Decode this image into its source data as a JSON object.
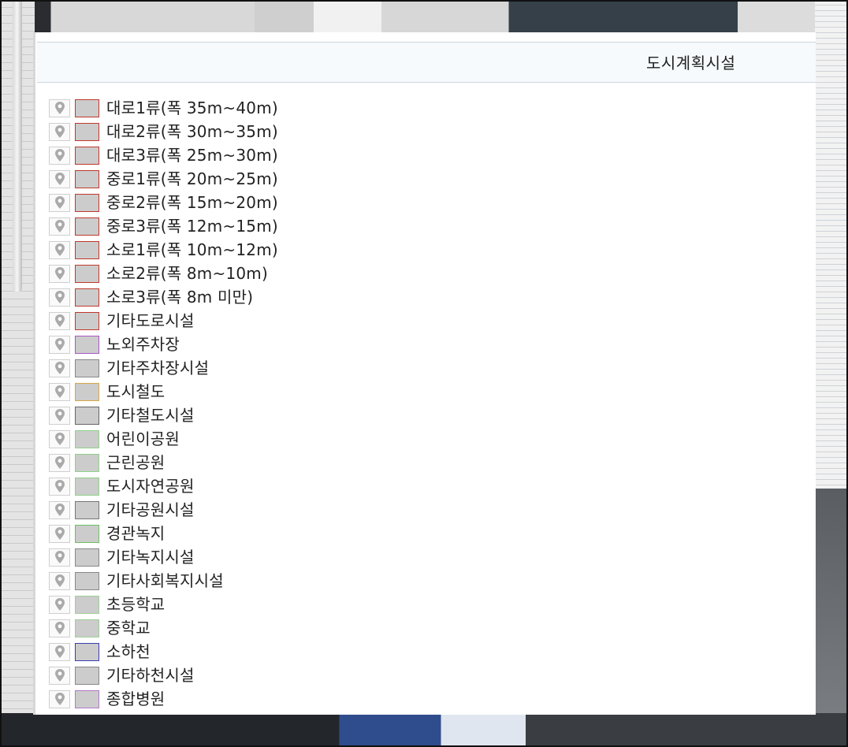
{
  "panel": {
    "title": "도시계획시설"
  },
  "legend": [
    {
      "label": "대로1류(폭 35m~40m)",
      "border": "#c0392b"
    },
    {
      "label": "대로2류(폭 30m~35m)",
      "border": "#c0392b"
    },
    {
      "label": "대로3류(폭 25m~30m)",
      "border": "#c0392b"
    },
    {
      "label": "중로1류(폭 20m~25m)",
      "border": "#c0392b"
    },
    {
      "label": "중로2류(폭 15m~20m)",
      "border": "#c0392b"
    },
    {
      "label": "중로3류(폭 12m~15m)",
      "border": "#c0392b"
    },
    {
      "label": "소로1류(폭 10m~12m)",
      "border": "#c0392b"
    },
    {
      "label": "소로2류(폭 8m~10m)",
      "border": "#c0392b"
    },
    {
      "label": "소로3류(폭 8m 미만)",
      "border": "#c0392b"
    },
    {
      "label": "기타도로시설",
      "border": "#c0392b"
    },
    {
      "label": "노외주차장",
      "border": "#a855c8"
    },
    {
      "label": "기타주차장시설",
      "border": "#888888"
    },
    {
      "label": "도시철도",
      "border": "#d6a84a"
    },
    {
      "label": "기타철도시설",
      "border": "#666666"
    },
    {
      "label": "어린이공원",
      "border": "#8fd18a"
    },
    {
      "label": "근린공원",
      "border": "#8fd18a"
    },
    {
      "label": "도시자연공원",
      "border": "#8fd18a"
    },
    {
      "label": "기타공원시설",
      "border": "#777777"
    },
    {
      "label": "경관녹지",
      "border": "#6bbf5f"
    },
    {
      "label": "기타녹지시설",
      "border": "#888888"
    },
    {
      "label": "기타사회복지시설",
      "border": "#888888"
    },
    {
      "label": "초등학교",
      "border": "#9ecf96"
    },
    {
      "label": "중학교",
      "border": "#9ecf96"
    },
    {
      "label": "소하천",
      "border": "#3b3fb0"
    },
    {
      "label": "기타하천시설",
      "border": "#888888"
    },
    {
      "label": "종합병원",
      "border": "#b07ac8"
    }
  ],
  "colors": {
    "swatch_fill": "#cccccc",
    "pin_icon": "#aaaaaa",
    "header_bg": "#f6fafd"
  },
  "icons": {
    "locate": "map-pin-icon"
  }
}
